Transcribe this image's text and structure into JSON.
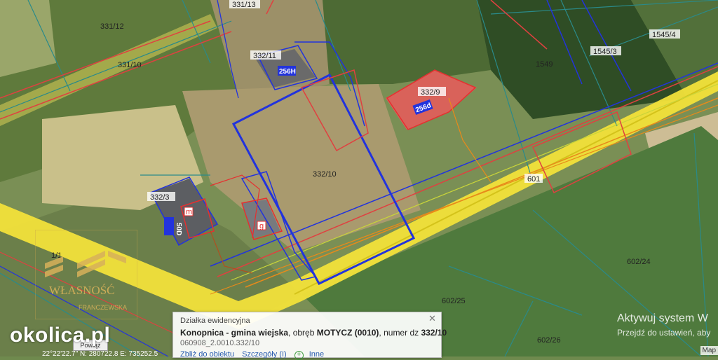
{
  "parcels": {
    "p331_13": "331/13",
    "p331_12": "331/12",
    "p331_10": "331/10",
    "p332_11": "332/11",
    "p332_9": "332/9",
    "p332_10": "332/10",
    "p332_3": "332/3",
    "p1545_4": "1545/4",
    "p1545_3": "1545/3",
    "p1549": "1549",
    "p601": "601",
    "p602_24": "602/24",
    "p602_25": "602/25",
    "p602_26": "602/26",
    "p1_1": "1/1"
  },
  "buildings": {
    "b256h": "256H",
    "b256d": "256d",
    "b50d": "50D",
    "m": "m",
    "g": "g"
  },
  "popup": {
    "header": "Działka ewidencyjna",
    "place": "Konopnica - gmina wiejska",
    "obreb_prefix": ", obręb ",
    "obreb": "MOTYCZ (0010)",
    "numer_prefix": ", numer dz ",
    "numer": "332/10",
    "identifier": "060908_2.0010.332/10",
    "link_zoom": "Zbliż do obiektu",
    "link_details": "Szczegóły (I)",
    "link_other": "Inne",
    "close_icon": "close-icon"
  },
  "watermark": {
    "site": "okolica.pl",
    "logo_text": "WŁASNOŚĆ",
    "logo_sub": "FRANCZEWSKA"
  },
  "system": {
    "activate_title": "Aktywuj system W",
    "activate_sub": "Przejdź do ustawień, aby",
    "map_tag": "Map",
    "scale": "Powiąż",
    "coords": "22°22'22.7\"  N: 280722.8  E: 735252.5"
  },
  "colors": {
    "parcel_border": "#2a8a8a",
    "plot_highlight": "#2233dd",
    "road": "#f2e23a",
    "building_red": "#e53030"
  }
}
